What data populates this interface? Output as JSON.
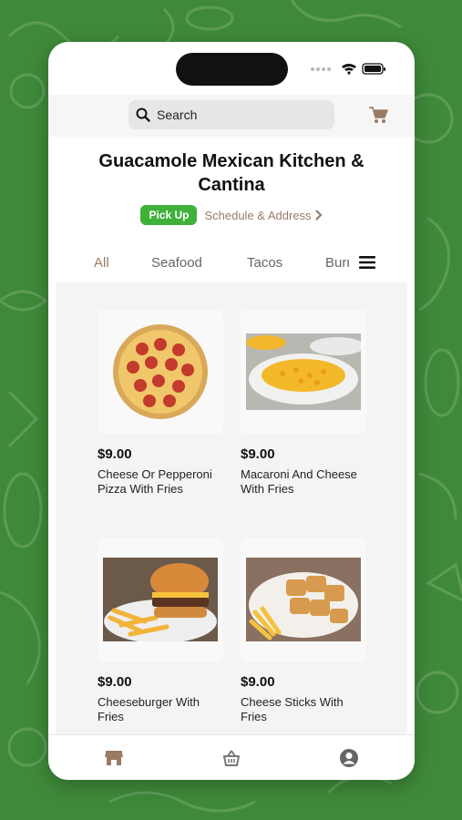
{
  "search": {
    "placeholder": "Search"
  },
  "store": {
    "title": "Guacamole Mexican Kitchen & Cantina",
    "order_mode": "Pick Up",
    "schedule_label": "Schedule & Address"
  },
  "categories": [
    {
      "label": "All",
      "active": true
    },
    {
      "label": "Seafood",
      "active": false
    },
    {
      "label": "Tacos",
      "active": false
    },
    {
      "label": "Burritos",
      "active": false
    }
  ],
  "products": [
    {
      "price": "$9.00",
      "name": "Cheese Or Pepperoni Pizza With Fries",
      "image": "pepperoni-pizza"
    },
    {
      "price": "$9.00",
      "name": "Macaroni And Cheese With Fries",
      "image": "macaroni-and-cheese"
    },
    {
      "price": "$9.00",
      "name": "Cheeseburger With Fries",
      "image": "cheeseburger-with-fries"
    },
    {
      "price": "$9.00",
      "name": "Cheese Sticks With Fries",
      "image": "cheese-sticks-with-fries"
    }
  ],
  "bottom_nav": [
    {
      "icon": "store-icon",
      "active": true
    },
    {
      "icon": "basket-icon",
      "active": false
    },
    {
      "icon": "account-icon",
      "active": false
    }
  ],
  "colors": {
    "background": "#3f8a3a",
    "accent": "#9a7b64",
    "pickup_badge": "#3fb13b"
  }
}
